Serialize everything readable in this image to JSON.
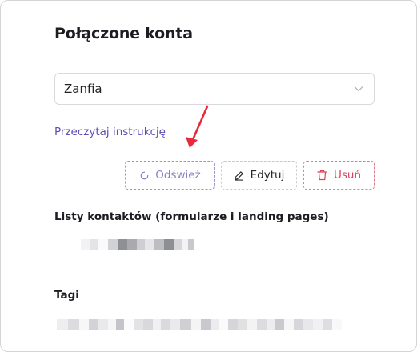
{
  "panel": {
    "title": "Połączone konta"
  },
  "account_select": {
    "selected": "Zanfia"
  },
  "instructions_link": "Przeczytaj instrukcję",
  "actions": {
    "refresh_label": "Odśwież",
    "edit_label": "Edytuj",
    "delete_label": "Usuń"
  },
  "sections": {
    "lists_label": "Listy kontaktów (formularze i landing pages)",
    "tags_label": "Tagi"
  },
  "icons": {
    "select": "chevron-down-icon",
    "refresh": "refresh-icon",
    "edit": "pencil-icon",
    "delete": "trash-icon",
    "annotation": "red-arrow-icon"
  },
  "colors": {
    "accent": "#5b4fb5",
    "danger": "#d9435a",
    "annotation_arrow": "#e8293c"
  }
}
